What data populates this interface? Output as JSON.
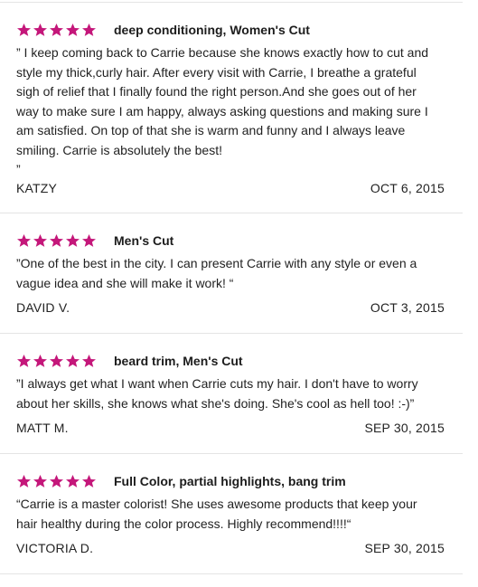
{
  "rating_color": "#c4177a",
  "star_icon": "star-icon",
  "reviews": [
    {
      "rating": 5,
      "service": "deep conditioning, Women's Cut",
      "lines": [
        "” I keep coming back to Carrie because she knows exactly how to cut and",
        "style my thick,curly hair.  After every visit with Carrie, I breathe a grateful",
        "sigh of relief that I finally found the right person.And  she goes out of her",
        "way to make sure I am happy, always asking questions and making sure I",
        "am satisfied. On top of that she is warm and funny and I always leave",
        "smiling. Carrie is absolutely the best!",
        "”"
      ],
      "author": "KATZY",
      "date": "OCT 6, 2015"
    },
    {
      "rating": 5,
      "service": "Men's Cut",
      "lines": [
        "”One of the best in the city. I can present Carrie with any style or even a",
        "vague idea and she will make it work! “"
      ],
      "author": "DAVID V.",
      "date": "OCT 3, 2015"
    },
    {
      "rating": 5,
      "service": "beard trim, Men's Cut",
      "lines": [
        "”I always get what I want when Carrie cuts my hair. I don't have to worry",
        "about her skills, she knows what she's doing. She's cool as hell too!  :-)”"
      ],
      "author": "MATT M.",
      "date": "SEP 30, 2015"
    },
    {
      "rating": 5,
      "service": "Full Color, partial highlights, bang trim",
      "lines": [
        "“Carrie is a master colorist! She uses awesome products that keep your",
        "hair healthy during the color process. Highly recommend!!!!“"
      ],
      "author": "VICTORIA D.",
      "date": "SEP 30, 2015"
    }
  ]
}
